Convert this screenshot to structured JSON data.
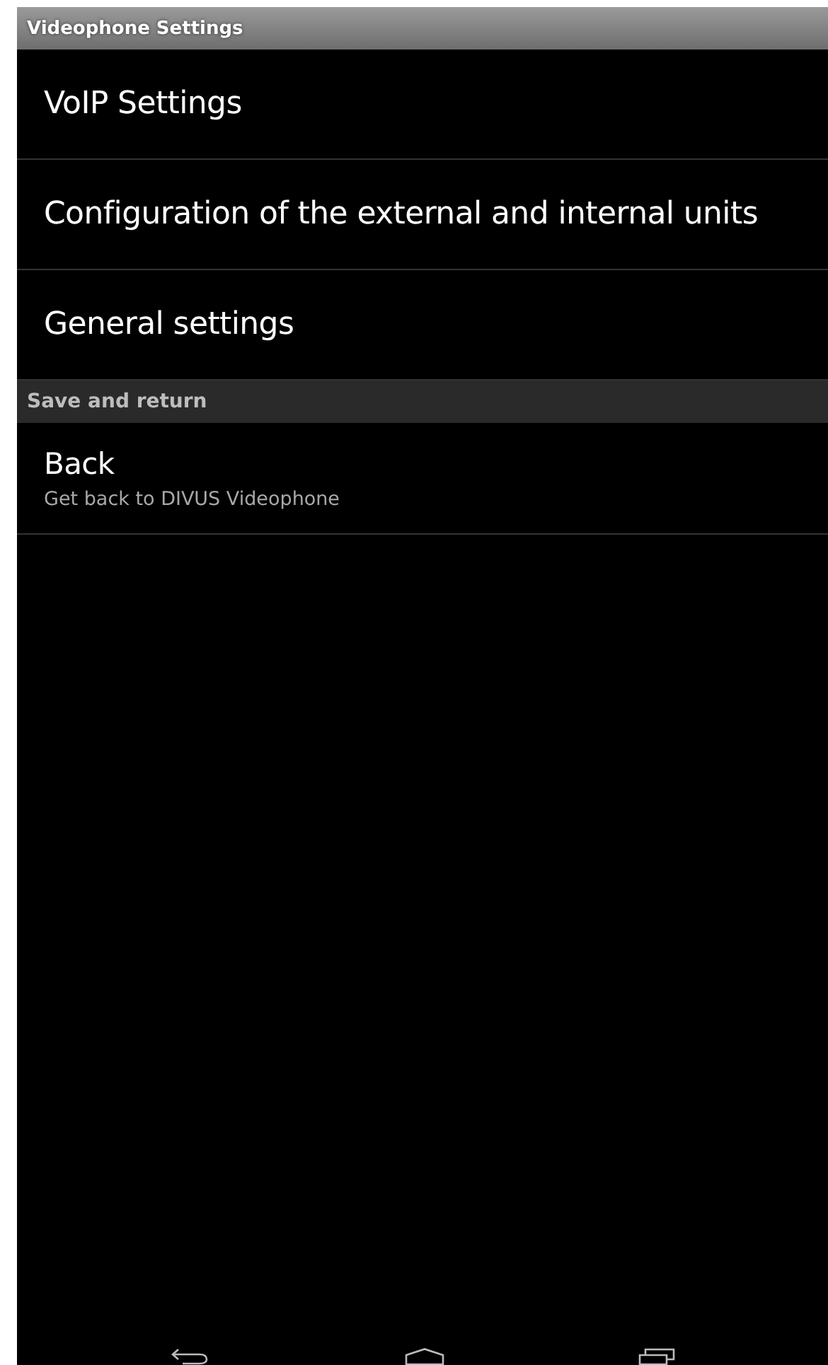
{
  "window": {
    "title": "Videophone Settings"
  },
  "sections": [
    {
      "items": [
        {
          "title": "VoIP Settings"
        },
        {
          "title": "Configuration of the external and internal units"
        },
        {
          "title": "General settings"
        }
      ]
    },
    {
      "header": "Save and return",
      "items": [
        {
          "title": "Back",
          "summary": "Get back to DIVUS Videophone"
        }
      ]
    }
  ],
  "nav_bar": [
    {
      "kind": "back"
    },
    {
      "kind": "home"
    },
    {
      "kind": "recents"
    }
  ]
}
